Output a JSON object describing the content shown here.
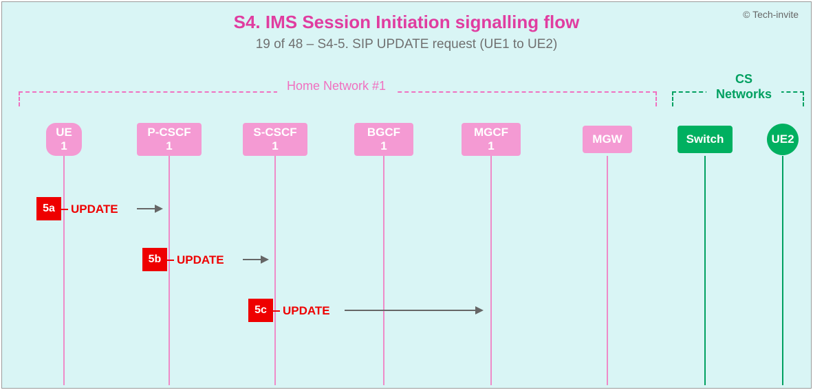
{
  "copyright": "© Tech-invite",
  "title": "S4. IMS Session Initiation signalling flow",
  "subtitle": "19 of 48 – S4-5. SIP UPDATE request (UE1 to UE2)",
  "groups": {
    "home_network": "Home Network #1",
    "cs_networks": "CS\nNetworks"
  },
  "nodes": {
    "ue1": {
      "line1": "UE",
      "line2": "1"
    },
    "pcscf": {
      "line1": "P-CSCF",
      "line2": "1"
    },
    "scscf": {
      "line1": "S-CSCF",
      "line2": "1"
    },
    "bgcf": {
      "line1": "BGCF",
      "line2": "1"
    },
    "mgcf": {
      "line1": "MGCF",
      "line2": "1"
    },
    "mgw": {
      "line1": "MGW",
      "line2": ""
    },
    "switch": {
      "line1": "Switch",
      "line2": ""
    },
    "ue2": {
      "line1": "UE2",
      "line2": ""
    }
  },
  "steps": {
    "s5a": {
      "id": "5a",
      "label": "UPDATE"
    },
    "s5b": {
      "id": "5b",
      "label": "UPDATE"
    },
    "s5c": {
      "id": "5c",
      "label": "UPDATE"
    }
  },
  "chart_data": {
    "type": "sequence-diagram",
    "participants": [
      {
        "id": "ue1",
        "label": "UE 1",
        "group": "Home Network #1"
      },
      {
        "id": "pcscf1",
        "label": "P-CSCF 1",
        "group": "Home Network #1"
      },
      {
        "id": "scscf1",
        "label": "S-CSCF 1",
        "group": "Home Network #1"
      },
      {
        "id": "bgcf1",
        "label": "BGCF 1",
        "group": "Home Network #1"
      },
      {
        "id": "mgcf1",
        "label": "MGCF 1",
        "group": "Home Network #1"
      },
      {
        "id": "mgw",
        "label": "MGW",
        "group": "Home Network #1"
      },
      {
        "id": "switch",
        "label": "Switch",
        "group": "CS Networks"
      },
      {
        "id": "ue2",
        "label": "UE2",
        "group": "CS Networks"
      }
    ],
    "messages": [
      {
        "step": "5a",
        "from": "ue1",
        "to": "pcscf1",
        "label": "UPDATE"
      },
      {
        "step": "5b",
        "from": "pcscf1",
        "to": "scscf1",
        "label": "UPDATE"
      },
      {
        "step": "5c",
        "from": "scscf1",
        "to": "mgcf1",
        "label": "UPDATE"
      }
    ]
  }
}
